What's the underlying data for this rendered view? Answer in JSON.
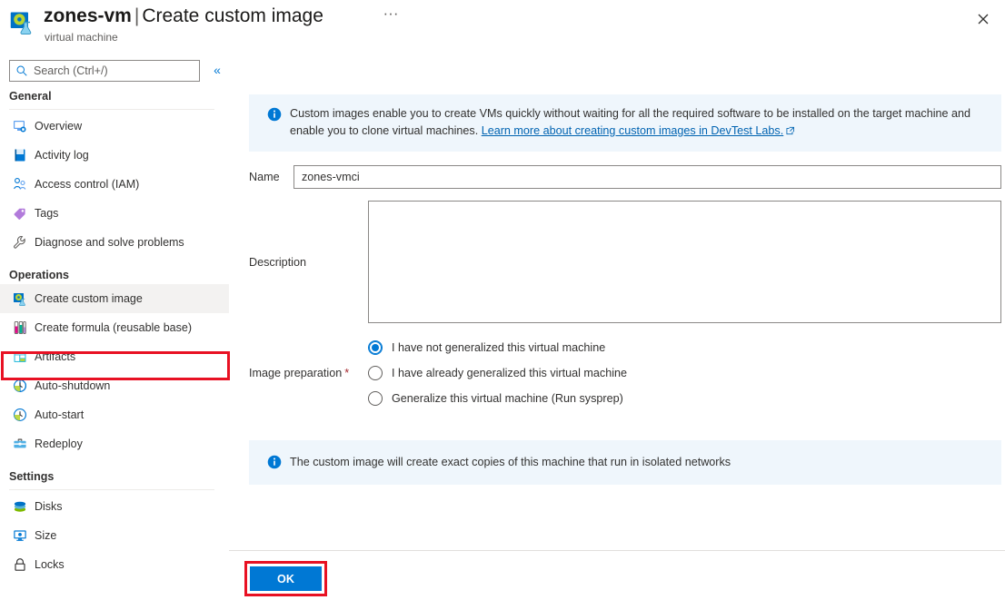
{
  "header": {
    "icon": "vm-custom-image-icon",
    "resource_name": "zones-vm",
    "separator": "|",
    "blade_title": "Create custom image",
    "subtitle": "virtual machine",
    "ellipsis": "···",
    "close_icon": "close-icon"
  },
  "search": {
    "placeholder": "Search (Ctrl+/)",
    "value": "",
    "icon": "search-icon",
    "collapse_icon": "«"
  },
  "sidebar": {
    "groups": [
      {
        "title": "General",
        "items": [
          {
            "label": "Overview",
            "icon": "monitor-icon"
          },
          {
            "label": "Activity log",
            "icon": "book-icon"
          },
          {
            "label": "Access control (IAM)",
            "icon": "people-icon"
          },
          {
            "label": "Tags",
            "icon": "tag-icon"
          },
          {
            "label": "Diagnose and solve problems",
            "icon": "wrench-icon"
          }
        ]
      },
      {
        "title": "Operations",
        "items": [
          {
            "label": "Create custom image",
            "icon": "custom-image-icon",
            "selected": true
          },
          {
            "label": "Create formula (reusable base)",
            "icon": "test-tubes-icon"
          },
          {
            "label": "Artifacts",
            "icon": "artifacts-icon"
          },
          {
            "label": "Auto-shutdown",
            "icon": "clock-icon"
          },
          {
            "label": "Auto-start",
            "icon": "clock-icon"
          },
          {
            "label": "Redeploy",
            "icon": "toolbox-icon"
          }
        ]
      },
      {
        "title": "Settings",
        "items": [
          {
            "label": "Disks",
            "icon": "disks-icon"
          },
          {
            "label": "Size",
            "icon": "size-icon"
          },
          {
            "label": "Locks",
            "icon": "lock-icon"
          }
        ]
      }
    ]
  },
  "main": {
    "info_top": {
      "icon": "info-icon",
      "text": "Custom images enable you to create VMs quickly without waiting for all the required software to be installed on the target machine and enable you to clone virtual machines. ",
      "link_text": "Learn more about creating custom images in DevTest Labs.",
      "link_external_icon": "external-link-icon"
    },
    "name_field": {
      "label": "Name",
      "value": "zones-vmci",
      "placeholder": ""
    },
    "description_field": {
      "label": "Description",
      "value": "",
      "placeholder": ""
    },
    "image_preparation": {
      "label": "Image preparation",
      "required_marker": "*",
      "options": [
        {
          "label": "I have not generalized this virtual machine",
          "checked": true
        },
        {
          "label": "I have already generalized this virtual machine",
          "checked": false
        },
        {
          "label": "Generalize this virtual machine (Run sysprep)",
          "checked": false
        }
      ]
    },
    "info_bottom": {
      "icon": "info-icon",
      "text": "The custom image will create exact copies of this machine that run in isolated networks"
    }
  },
  "footer": {
    "ok_label": "OK"
  },
  "colors": {
    "accent": "#0078d4",
    "info_background": "#eff6fc",
    "highlight_red": "#e81123",
    "link": "#0063b1",
    "selected_nav_background": "#f3f2f1",
    "required_star": "#a4262c"
  }
}
